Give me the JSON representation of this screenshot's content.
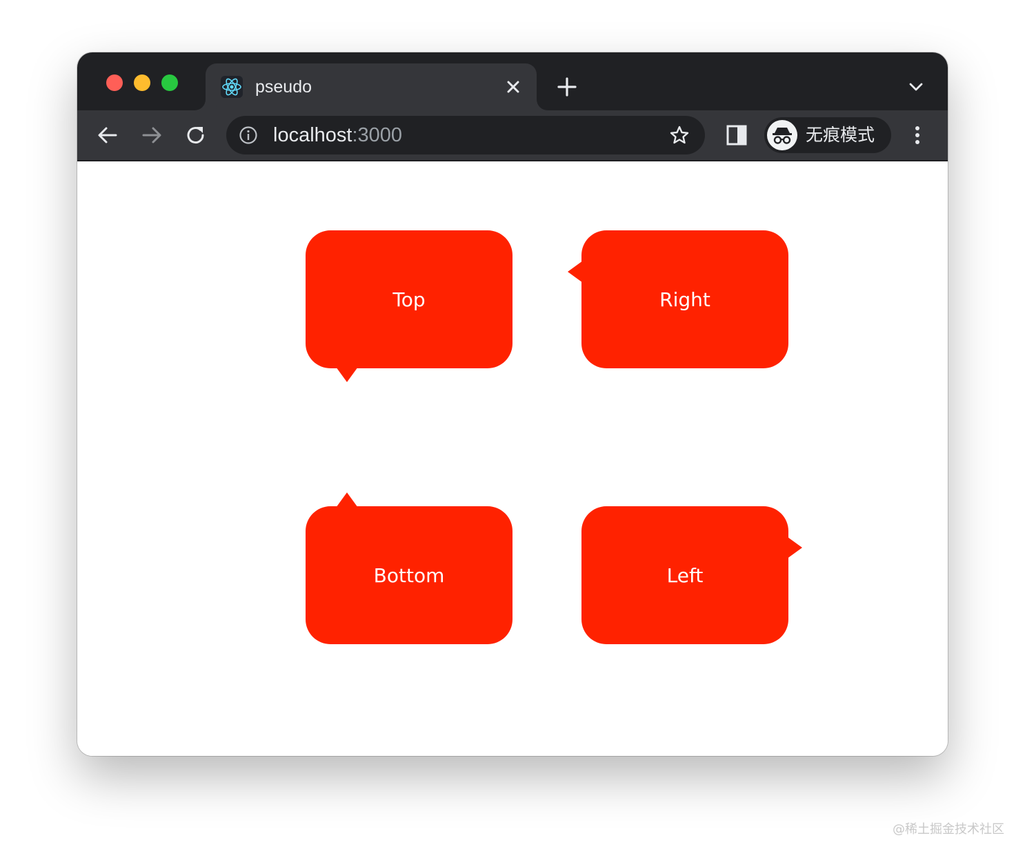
{
  "browser": {
    "tab_title": "pseudo",
    "url_host": "localhost",
    "url_port": ":3000",
    "profile_label": "无痕模式"
  },
  "bubbles": [
    {
      "label": "Top",
      "tail": "bottom-left"
    },
    {
      "label": "Right",
      "tail": "left-top"
    },
    {
      "label": "Bottom",
      "tail": "top-left"
    },
    {
      "label": "Left",
      "tail": "right-top"
    }
  ],
  "colors": {
    "bubble": "#ff2200",
    "tab_strip": "#202124",
    "toolbar": "#35363a"
  },
  "watermark": "@稀土掘金技术社区"
}
